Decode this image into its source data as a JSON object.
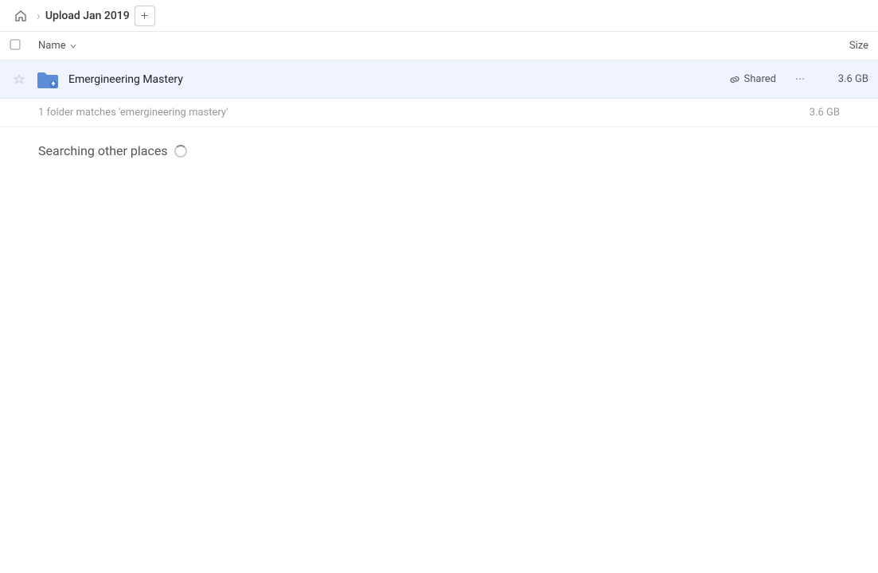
{
  "header": {
    "home_label": "Home",
    "breadcrumb_label": "Upload Jan 2019",
    "new_btn_label": "+"
  },
  "columns": {
    "name_label": "Name",
    "size_label": "Size"
  },
  "file": {
    "name": "Emergineering Mastery",
    "shared_label": "Shared",
    "size": "3.6 GB"
  },
  "match_info": {
    "text": "1 folder matches 'emergineering mastery'",
    "size": "3.6 GB"
  },
  "searching": {
    "label": "Searching other places"
  }
}
